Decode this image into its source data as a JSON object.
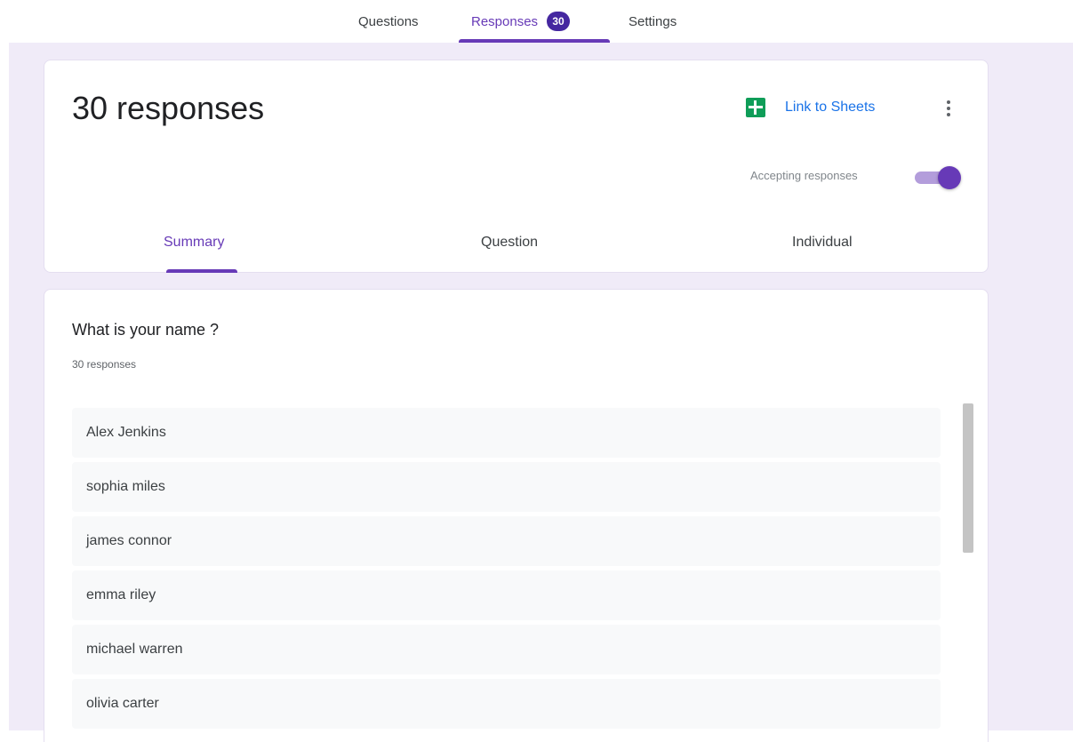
{
  "nav": {
    "tabs": [
      {
        "label": "Questions"
      },
      {
        "label": "Responses",
        "badge": "30"
      },
      {
        "label": "Settings"
      }
    ],
    "active_tab": "Responses"
  },
  "header": {
    "title": "30 responses",
    "link_sheets_label": "Link to Sheets",
    "accepting_label": "Accepting responses",
    "accepting_on": true
  },
  "sub_tabs": [
    {
      "label": "Summary"
    },
    {
      "label": "Question"
    },
    {
      "label": "Individual"
    }
  ],
  "question": {
    "title": "What is your name ?",
    "count": "30 responses",
    "responses": [
      "Alex Jenkins",
      "sophia miles",
      "james connor",
      "emma riley",
      "michael warren",
      "olivia carter"
    ]
  },
  "colors": {
    "accent": "#673ab7",
    "badge": "#4527a0",
    "page_bg": "#f0ebf8",
    "link": "#1a73e8",
    "sheets_green": "#0f9d58"
  }
}
